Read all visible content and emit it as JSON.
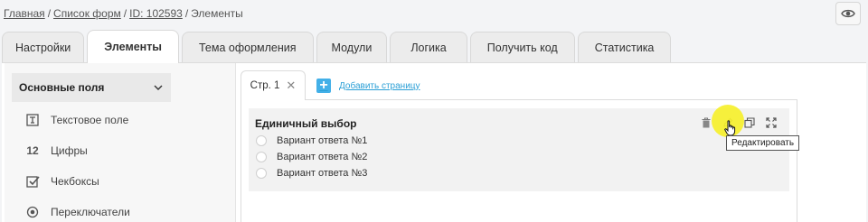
{
  "breadcrumb": {
    "items": [
      "Главная",
      "Список форм",
      "ID: 102593"
    ],
    "current": "Элементы",
    "separator": "/"
  },
  "header": {
    "preview_icon": "eye-icon"
  },
  "tabs": [
    {
      "label": "Настройки",
      "active": false
    },
    {
      "label": "Элементы",
      "active": true
    },
    {
      "label": "Тема оформления",
      "active": false
    },
    {
      "label": "Модули",
      "active": false
    },
    {
      "label": "Логика",
      "active": false
    },
    {
      "label": "Получить код",
      "active": false
    },
    {
      "label": "Статистика",
      "active": false
    }
  ],
  "sidebar": {
    "group_label": "Основные поля",
    "items": [
      {
        "label": "Текстовое поле",
        "icon": "text-field-icon"
      },
      {
        "label": "Цифры",
        "icon": "numbers-icon",
        "icon_text": "12"
      },
      {
        "label": "Чекбоксы",
        "icon": "checkbox-icon"
      },
      {
        "label": "Переключатели",
        "icon": "radio-icon"
      }
    ]
  },
  "pages": {
    "tab_label": "Стр. 1",
    "add_label": "Добавить страницу"
  },
  "question": {
    "title": "Единичный выбор",
    "options": [
      "Вариант ответа №1",
      "Вариант ответа №2",
      "Вариант ответа №3"
    ],
    "tools": [
      "trash-icon",
      "edit-icon",
      "copy-icon",
      "expand-icon"
    ],
    "tooltip": "Редактировать"
  },
  "colors": {
    "accent": "#43b0e8",
    "link": "#2a9fd6",
    "highlight": "#f6f028"
  }
}
